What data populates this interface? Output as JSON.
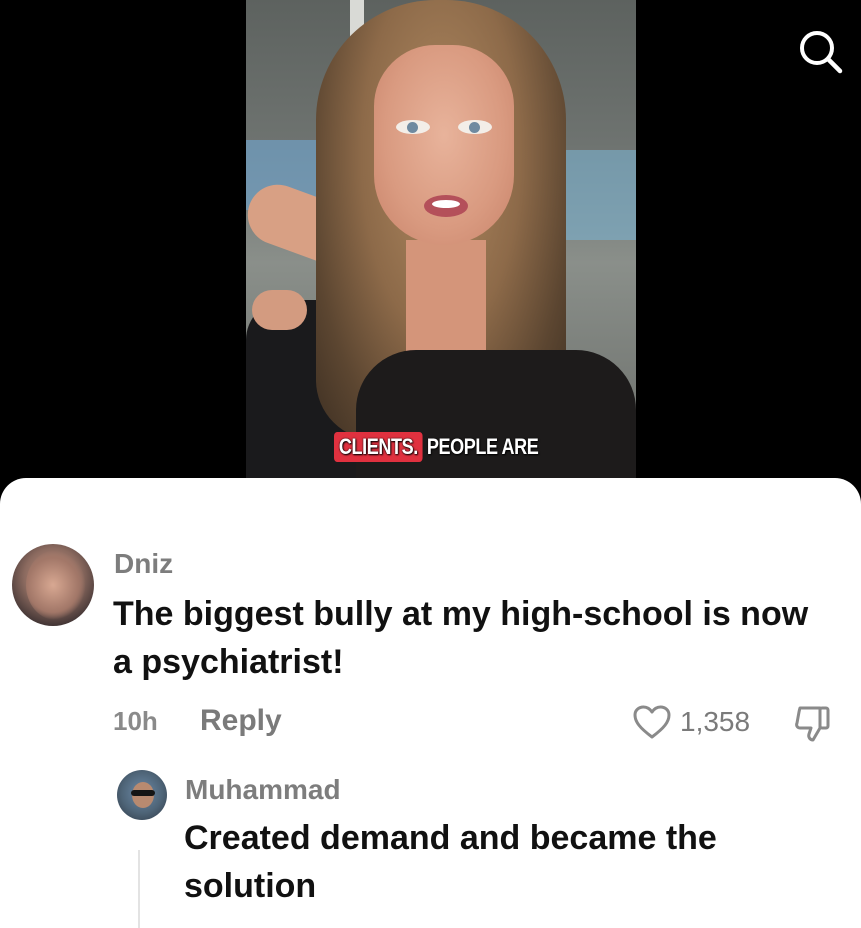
{
  "video": {
    "caption_highlight": "CLIENTS.",
    "caption_rest": "PEOPLE ARE"
  },
  "header": {
    "search_icon": "search-icon"
  },
  "comments": [
    {
      "username": "Dniz",
      "text": "The biggest bully at my high-school is now a psychiatrist!",
      "time": "10h",
      "reply_label": "Reply",
      "like_count": "1,358"
    },
    {
      "username": "Muhammad",
      "text": "Created demand and became the solution"
    }
  ],
  "colors": {
    "caption_highlight": "#e0313f",
    "muted_text": "#7a7a7a",
    "body_text": "#111111"
  }
}
